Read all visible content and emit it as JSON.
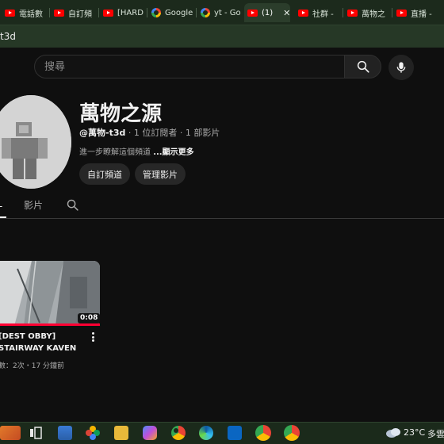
{
  "tabs": [
    {
      "label": "電話數",
      "icon": "youtube-icon",
      "active": false
    },
    {
      "label": "自訂頻",
      "icon": "youtube-icon",
      "active": false
    },
    {
      "label": "[HARD",
      "icon": "youtube-icon",
      "active": false
    },
    {
      "label": "Google",
      "icon": "google-icon",
      "active": false
    },
    {
      "label": "yt - Go",
      "icon": "google-icon",
      "active": false
    },
    {
      "label": "(1)",
      "icon": "youtube-icon",
      "active": true
    },
    {
      "label": "社群 -",
      "icon": "youtube-icon",
      "active": false
    },
    {
      "label": "萬物之",
      "icon": "youtube-icon",
      "active": false
    },
    {
      "label": "直播 -",
      "icon": "youtube-icon",
      "active": false
    }
  ],
  "tab_close_glyph": "✕",
  "address_bar": {
    "url_fragment": "t3d"
  },
  "search": {
    "placeholder": "搜尋"
  },
  "channel": {
    "name": "萬物之源",
    "handle": "@萬物-t3d",
    "subscribers": "1 位訂閱者",
    "videos_count": "1 部影片",
    "meta_separator": " · ",
    "description": "進一步瞭解這個頻道",
    "show_more": "...顯示更多",
    "customize_button": "自訂頻道",
    "manage_button": "管理影片"
  },
  "channel_tabs": {
    "selected_fragment": "L",
    "videos_tab": "影片"
  },
  "video": {
    "title": "[DEST OBBY] STAIRWAY KAVEN",
    "duration": "0:08",
    "meta": "數：2次・17 分鐘前"
  },
  "taskbar": {
    "temperature": "23°C",
    "weather": "多雲"
  },
  "colors": {
    "background": "#0f0f0f",
    "youtube_red": "#ff0000",
    "progress_red": "#ff0033",
    "chrome_green": "#263826"
  }
}
